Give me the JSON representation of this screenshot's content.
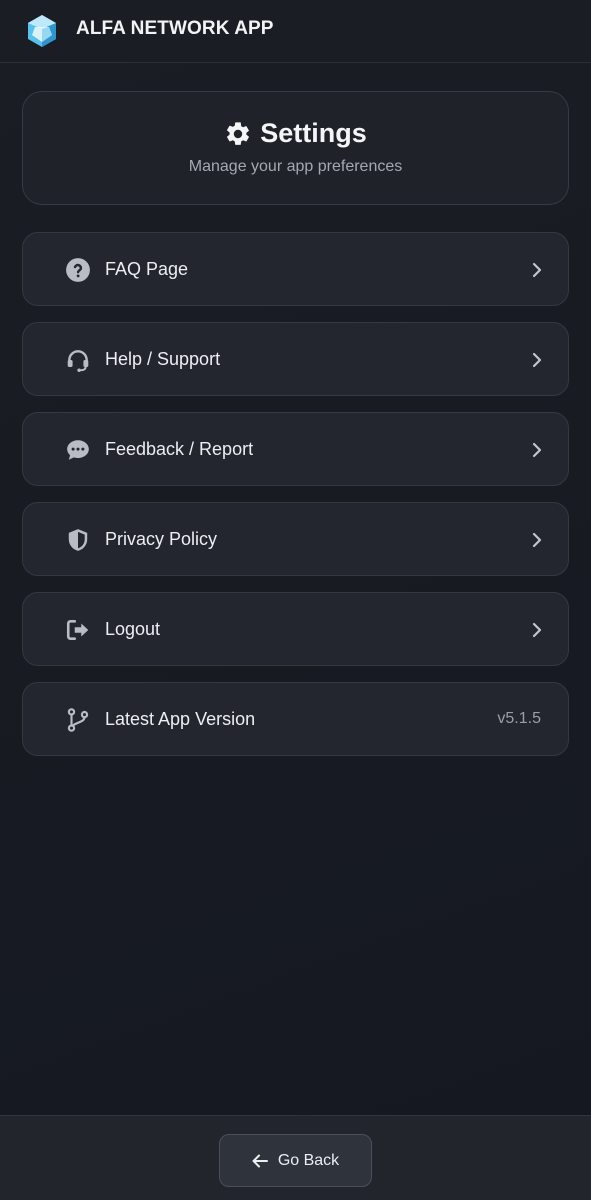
{
  "app": {
    "title": "ALFA NETWORK APP",
    "logo_icon": "hexagon-gem-logo"
  },
  "header": {
    "title": "Settings",
    "icon": "gear-icon",
    "subtitle": "Manage your app preferences"
  },
  "menu": [
    {
      "label": "FAQ Page",
      "icon": "question-circle-icon",
      "trailing": "chevron-right-icon"
    },
    {
      "label": "Help / Support",
      "icon": "headset-icon",
      "trailing": "chevron-right-icon"
    },
    {
      "label": "Feedback / Report",
      "icon": "chat-bubble-icon",
      "trailing": "chevron-right-icon"
    },
    {
      "label": "Privacy Policy",
      "icon": "shield-icon",
      "trailing": "chevron-right-icon"
    },
    {
      "label": "Logout",
      "icon": "logout-icon",
      "trailing": "chevron-right-icon"
    },
    {
      "label": "Latest App Version",
      "icon": "code-branch-icon",
      "value": "v5.1.5"
    }
  ],
  "footer": {
    "back_label": "Go Back",
    "back_icon": "arrow-left-icon"
  },
  "colors": {
    "background": "#181b22",
    "card": "#23262e",
    "card_border": "#343842",
    "text_primary": "#eceef1",
    "text_secondary": "#a4a8b0",
    "logo_accent": "#4fb8e8"
  }
}
